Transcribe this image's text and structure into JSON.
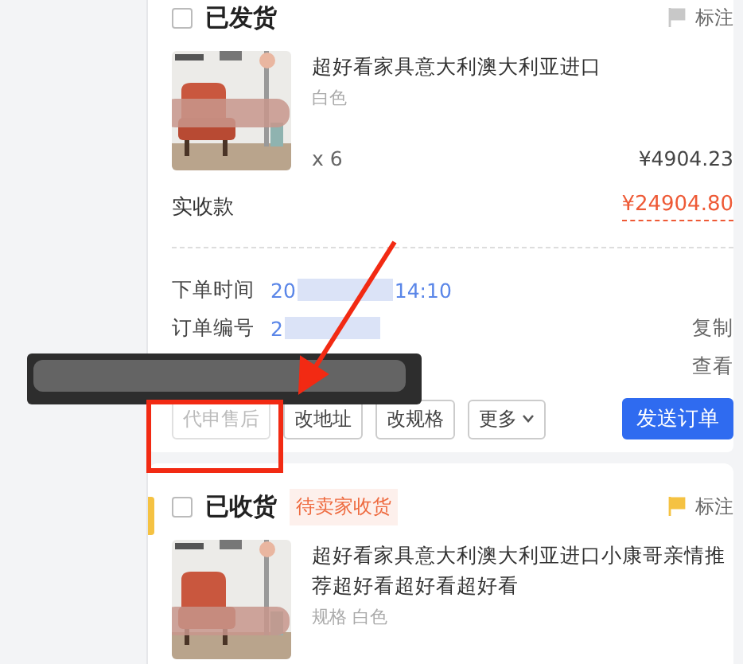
{
  "orders": [
    {
      "status": "已发货",
      "checked": false,
      "flagged": false,
      "mark_label": "标注",
      "product": {
        "title": "超好看家具意大利澳大利亚进口",
        "spec": "白色",
        "quantity": "x 6",
        "price": "¥4904.23"
      },
      "total_label": "实收款",
      "total": "¥24904.80",
      "details": [
        {
          "label": "下单时间",
          "value_start": "20",
          "value_end": "14:10"
        },
        {
          "label": "订单编号",
          "value_start": "2",
          "action": "复制"
        },
        {
          "action": "查看"
        }
      ],
      "buttons": [
        {
          "label": "代申售后",
          "kind": "outline",
          "disabled": true
        },
        {
          "label": "改地址",
          "kind": "outline",
          "disabled": false
        },
        {
          "label": "改规格",
          "kind": "outline",
          "disabled": false
        },
        {
          "label": "更多",
          "kind": "menu",
          "disabled": false
        },
        {
          "label": "发送订单",
          "kind": "primary",
          "disabled": false
        }
      ]
    },
    {
      "status": "已收货",
      "tag": "待卖家收货",
      "checked": false,
      "flagged": true,
      "mark_label": "标注",
      "product": {
        "title": "超好看家具意大利澳大利亚进口小康哥亲情推荐超好看超好看超好看",
        "spec": "规格 白色"
      }
    }
  ]
}
